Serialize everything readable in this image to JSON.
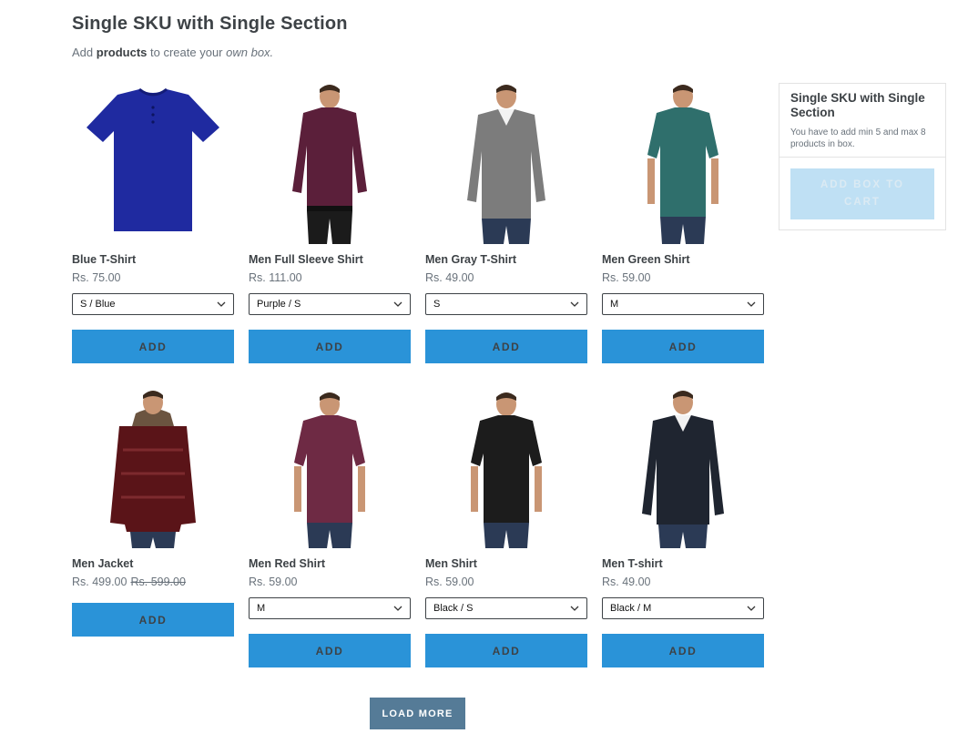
{
  "header": {
    "title": "Single SKU with Single Section",
    "subtitle_prefix": "Add",
    "subtitle_bold": "products",
    "subtitle_mid": "to create your",
    "subtitle_italic": "own box."
  },
  "products": [
    {
      "name": "Blue T-Shirt",
      "price": "Rs. 75.00",
      "compare_price": "",
      "variant": "S / Blue",
      "add_label": "ADD"
    },
    {
      "name": "Men Full Sleeve Shirt",
      "price": "Rs. 111.00",
      "compare_price": "",
      "variant": "Purple / S",
      "add_label": "ADD"
    },
    {
      "name": "Men Gray T-Shirt",
      "price": "Rs. 49.00",
      "compare_price": "",
      "variant": "S",
      "add_label": "ADD"
    },
    {
      "name": "Men Green Shirt",
      "price": "Rs. 59.00",
      "compare_price": "",
      "variant": "M",
      "add_label": "ADD"
    },
    {
      "name": "Men Jacket",
      "price": "Rs. 499.00",
      "compare_price": "Rs. 599.00",
      "variant": "",
      "add_label": "ADD"
    },
    {
      "name": "Men Red Shirt",
      "price": "Rs. 59.00",
      "compare_price": "",
      "variant": "M",
      "add_label": "ADD"
    },
    {
      "name": "Men Shirt",
      "price": "Rs. 59.00",
      "compare_price": "",
      "variant": "Black / S",
      "add_label": "ADD"
    },
    {
      "name": "Men T-shirt",
      "price": "Rs. 49.00",
      "compare_price": "",
      "variant": "Black / M",
      "add_label": "ADD"
    }
  ],
  "box_panel": {
    "title": "Single SKU with Single Section",
    "description": "You have to add min 5 and max 8 products in box.",
    "button_label": "ADD BOX TO CART"
  },
  "load_more_label": "LOAD MORE",
  "colors": {
    "add_button": "#2a93d8",
    "add_box_disabled": "#bfe0f4",
    "load_more": "#557b97"
  },
  "icons": {
    "select": "chevron-down-icon"
  }
}
